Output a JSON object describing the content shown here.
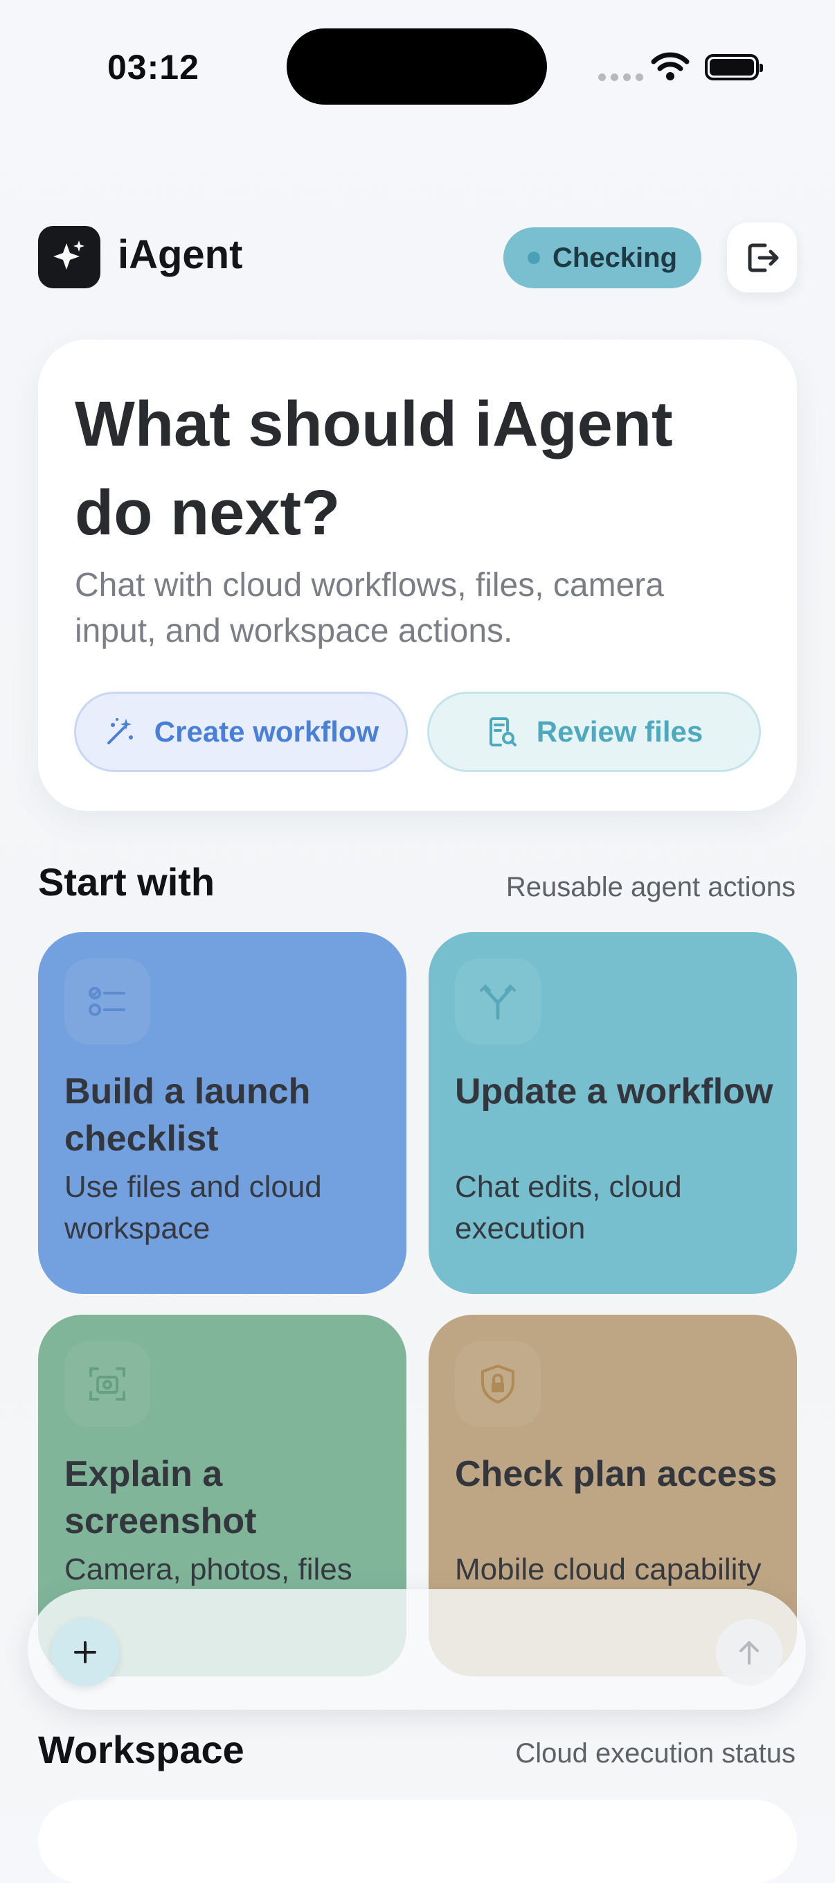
{
  "status_bar": {
    "time": "03:12"
  },
  "header": {
    "app_name": "iAgent",
    "connection_status": "Checking"
  },
  "hero": {
    "title": "What should iAgent do next?",
    "subtitle": "Chat with cloud workflows, files, camera input, and workspace actions.",
    "primary_action": "Create workflow",
    "secondary_action": "Review files"
  },
  "start_with": {
    "title": "Start with",
    "caption": "Reusable agent actions",
    "cards": [
      {
        "title": "Build a launch checklist",
        "description": "Use files and cloud workspace",
        "icon": "checklist-icon",
        "color": "#73a0de"
      },
      {
        "title": "Update a workflow",
        "description": "Chat edits, cloud execution",
        "icon": "branch-icon",
        "color": "#77bfce"
      },
      {
        "title": "Explain a screenshot",
        "description": "Camera, photos, files",
        "icon": "camera-scan-icon",
        "color": "#81b59a"
      },
      {
        "title": "Check plan access",
        "description": "Mobile cloud capability",
        "icon": "shield-lock-icon",
        "color": "#bea684"
      }
    ]
  },
  "workspace": {
    "title": "Workspace",
    "caption": "Cloud execution status"
  },
  "colors": {
    "primary_blue": "#4a7fd7",
    "teal": "#4ea9bf",
    "status_pill": "#79bfcf"
  }
}
